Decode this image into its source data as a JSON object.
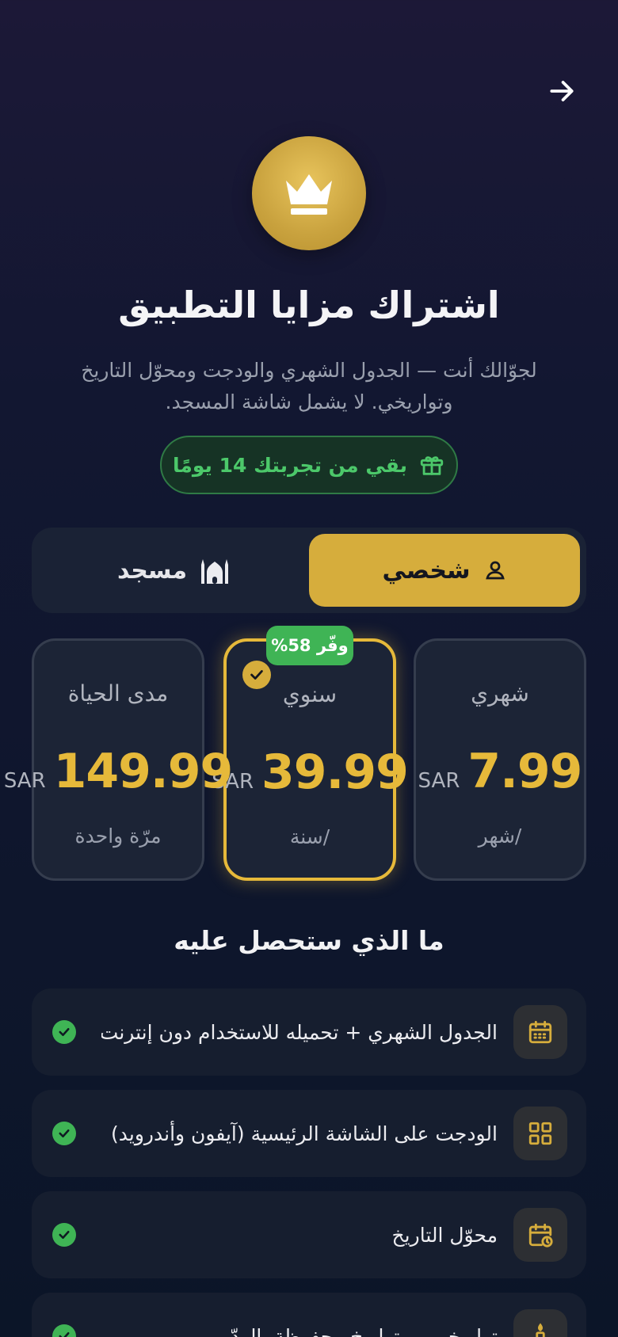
{
  "header": {
    "title": "اشتراك مزايا التطبيق",
    "subtitle": "لجوّالك أنت — الجدول الشهري والودجت ومحوّل التاريخ وتواريخي. لا يشمل شاشة المسجد.",
    "back_icon": "arrow-right-icon",
    "crown_icon": "crown-icon"
  },
  "trial": {
    "label": "بقي من تجربتك 14 يومًا",
    "icon": "gift-icon"
  },
  "segments": [
    {
      "label": "شخصي",
      "icon": "user-icon",
      "active": true
    },
    {
      "label": "مسجد",
      "icon": "mosque-icon",
      "active": false
    }
  ],
  "plans": [
    {
      "name": "شهري",
      "amount": "7.99",
      "currency": "SAR",
      "period": "/شهر",
      "selected": false
    },
    {
      "name": "سنوي",
      "amount": "39.99",
      "currency": "SAR",
      "period": "/سنة",
      "selected": true,
      "badge": "وفّر 58%"
    },
    {
      "name": "مدى الحياة",
      "amount": "149.99",
      "currency": "SAR",
      "period": "مرّة واحدة",
      "selected": false
    }
  ],
  "features_title": "ما الذي ستحصل عليه",
  "features": [
    {
      "label": "الجدول الشهري + تحميله للاستخدام دون إنترنت",
      "icon": "calendar-grid-icon"
    },
    {
      "label": "الودجت على الشاشة الرئيسية (آيفون وأندرويد)",
      "icon": "widgets-grid-icon"
    },
    {
      "label": "محوّل التاريخ",
      "icon": "calendar-convert-icon"
    },
    {
      "label": "تواريخي — تواريخ محفوظة بالردّ",
      "icon": "candle-icon"
    }
  ],
  "colors": {
    "accent_gold": "#d6ad3c",
    "price_gold": "#e6b93a",
    "success_green": "#3fb455",
    "background": "#121731"
  }
}
